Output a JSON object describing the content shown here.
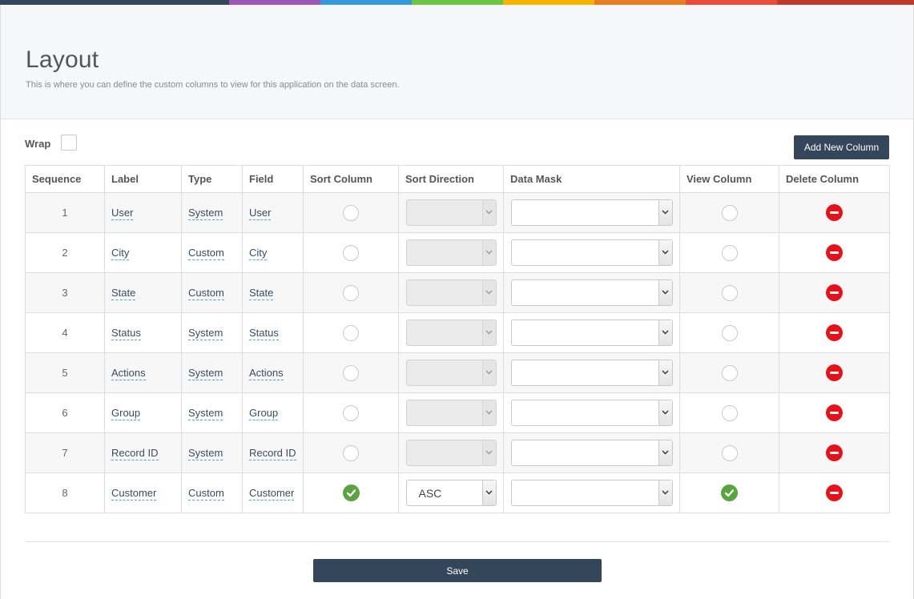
{
  "topbar_colors": [
    "#34465a",
    "#9b59b6",
    "#3498db",
    "#6cc644",
    "#f5b400",
    "#e67e22",
    "#e74c3c",
    "#c0392b"
  ],
  "header": {
    "title": "Layout",
    "subtitle": "This is where you can define the custom columns to view for this application on the data screen."
  },
  "controls": {
    "wrap_label": "Wrap",
    "add_button": "Add New Column",
    "save_button": "Save"
  },
  "table": {
    "columns": [
      "Sequence",
      "Label",
      "Type",
      "Field",
      "Sort Column",
      "Sort Direction",
      "Data Mask",
      "View Column",
      "Delete Column"
    ],
    "rows": [
      {
        "seq": "1",
        "label": "User",
        "type": "System",
        "field": "User",
        "sort": false,
        "direction": "",
        "view": false
      },
      {
        "seq": "2",
        "label": "City",
        "type": "Custom",
        "field": "City",
        "sort": false,
        "direction": "",
        "view": false
      },
      {
        "seq": "3",
        "label": "State",
        "type": "Custom",
        "field": "State",
        "sort": false,
        "direction": "",
        "view": false
      },
      {
        "seq": "4",
        "label": "Status",
        "type": "System",
        "field": "Status",
        "sort": false,
        "direction": "",
        "view": false
      },
      {
        "seq": "5",
        "label": "Actions",
        "type": "System",
        "field": "Actions",
        "sort": false,
        "direction": "",
        "view": false
      },
      {
        "seq": "6",
        "label": "Group",
        "type": "System",
        "field": "Group",
        "sort": false,
        "direction": "",
        "view": false
      },
      {
        "seq": "7",
        "label": "Record ID",
        "type": "System",
        "field": "Record ID",
        "sort": false,
        "direction": "",
        "view": false
      },
      {
        "seq": "8",
        "label": "Customer",
        "type": "Custom",
        "field": "Customer",
        "sort": true,
        "direction": "ASC",
        "view": true
      }
    ]
  },
  "colors": {
    "accent_dark": "#34465a",
    "check_green": "#5aa43f",
    "delete_red": "#e8111a"
  }
}
